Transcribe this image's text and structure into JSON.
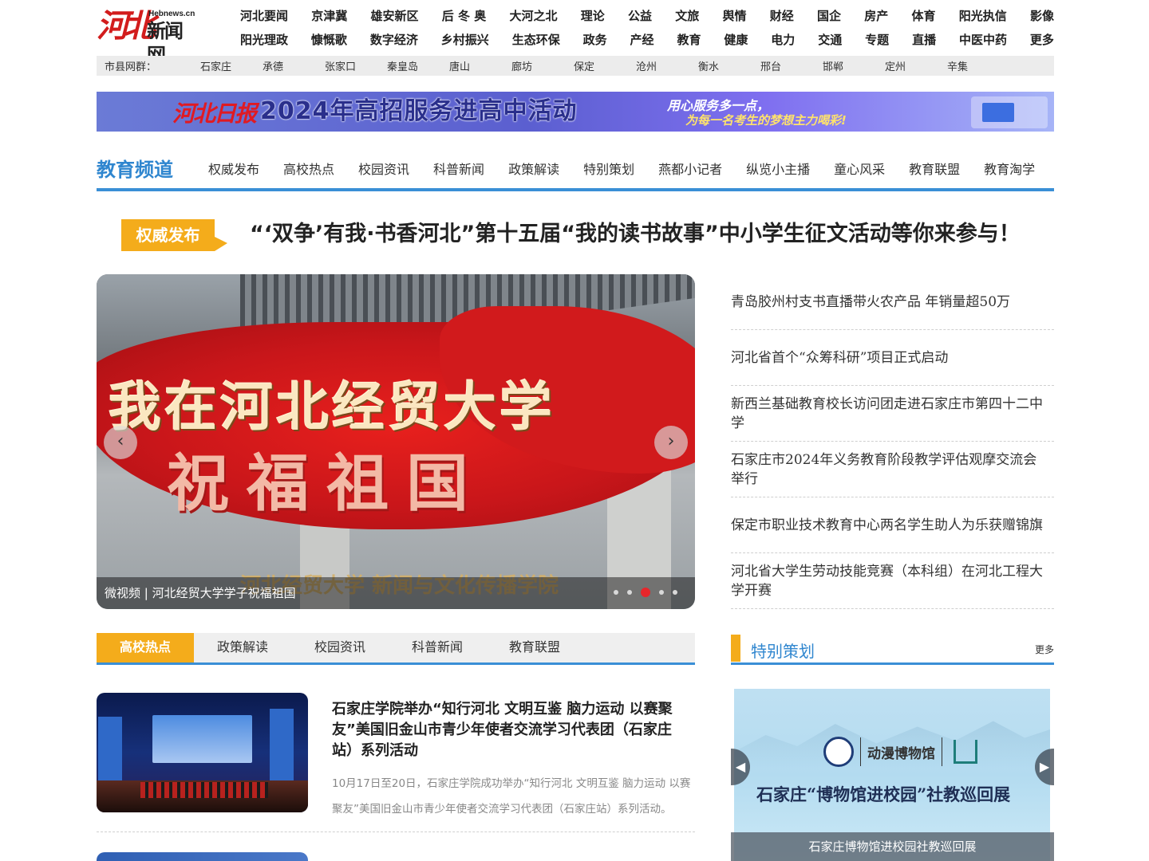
{
  "logo": {
    "mark": "河北",
    "en": "Hebnews.cn",
    "cn": "新闻网"
  },
  "topnav": {
    "row1": [
      "河北要闻",
      "京津冀",
      "雄安新区",
      "后 冬 奥",
      "大河之北",
      "理论",
      "公益",
      "文旅",
      "舆情",
      "财经",
      "国企",
      "房产",
      "体育",
      "阳光执信",
      "影像"
    ],
    "row2": [
      "阳光理政",
      "慷慨歌",
      "数字经济",
      "乡村振兴",
      "生态环保",
      "政务",
      "产经",
      "教育",
      "健康",
      "电力",
      "交通",
      "专题",
      "直播",
      "中医中药",
      "更多"
    ]
  },
  "citybar": {
    "label": "市县网群：",
    "cities": [
      "石家庄",
      "承德",
      "张家口",
      "秦皇岛",
      "唐山",
      "廊坊",
      "保定",
      "沧州",
      "衡水",
      "邢台",
      "邯郸",
      "定州",
      "辛集"
    ]
  },
  "banner": {
    "logo": "河北日报",
    "main": "2024年高招服务进高中活动",
    "sub1": "用心服务多一点，",
    "sub2": "为每一名考生的梦想主力喝彩!"
  },
  "channel": {
    "title": "教育频道",
    "items": [
      "权威发布",
      "高校热点",
      "校园资讯",
      "科普新闻",
      "政策解读",
      "特别策划",
      "燕都小记者",
      "纵览小主播",
      "童心风采",
      "教育联盟",
      "教育淘学"
    ]
  },
  "headline": {
    "badge": "权威发布",
    "text": "“‘双争’有我·书香河北”第十五届“我的读书故事”中小学生征文活动等你来参与！"
  },
  "slider": {
    "line1": "我在河北经贸大学",
    "line2": "祝福祖国",
    "footer": "河北经贸大学 新闻与文化传播学院",
    "caption": "微视频 | 河北经贸大学学子祝福祖国",
    "prev": "‹",
    "next": "›",
    "active_dot": 3,
    "dot_count": 5
  },
  "newslist": [
    "青岛胶州村支书直播带火农产品 年销量超50万",
    "河北省首个“众筹科研”项目正式启动",
    "新西兰基础教育校长访问团走进石家庄市第四十二中学",
    "石家庄市2024年义务教育阶段教学评估观摩交流会举行",
    "保定市职业技术教育中心两名学生助人为乐获赠锦旗",
    "河北省大学生劳动技能竞赛（本科组）在河北工程大学开赛"
  ],
  "tabs": [
    "高校热点",
    "政策解读",
    "校园资讯",
    "科普新闻",
    "教育联盟"
  ],
  "article": {
    "headline": "石家庄学院举办“知行河北 文明互鉴 脑力运动 以赛聚友”美国旧金山市青少年使者交流学习代表团（石家庄站）系列活动",
    "summary": "10月17日至20日，石家庄学院成功举办“知行河北 文明互鉴 脑力运动 以赛聚友”美国旧金山市青少年使者交流学习代表团（石家庄站）系列活动。"
  },
  "special": {
    "title": "特别策划",
    "more": "更多",
    "logo_text": "动漫博物馆",
    "pic_title": "石家庄“博物馆进校园”社教巡回展",
    "caption": "石家庄博物馆进校园社教巡回展",
    "prev": "◀",
    "next": "▶"
  },
  "colors": {
    "accent_blue": "#3a8fd6",
    "badge_orange": "#f4ac1b",
    "logo_red": "#d21c1c"
  }
}
